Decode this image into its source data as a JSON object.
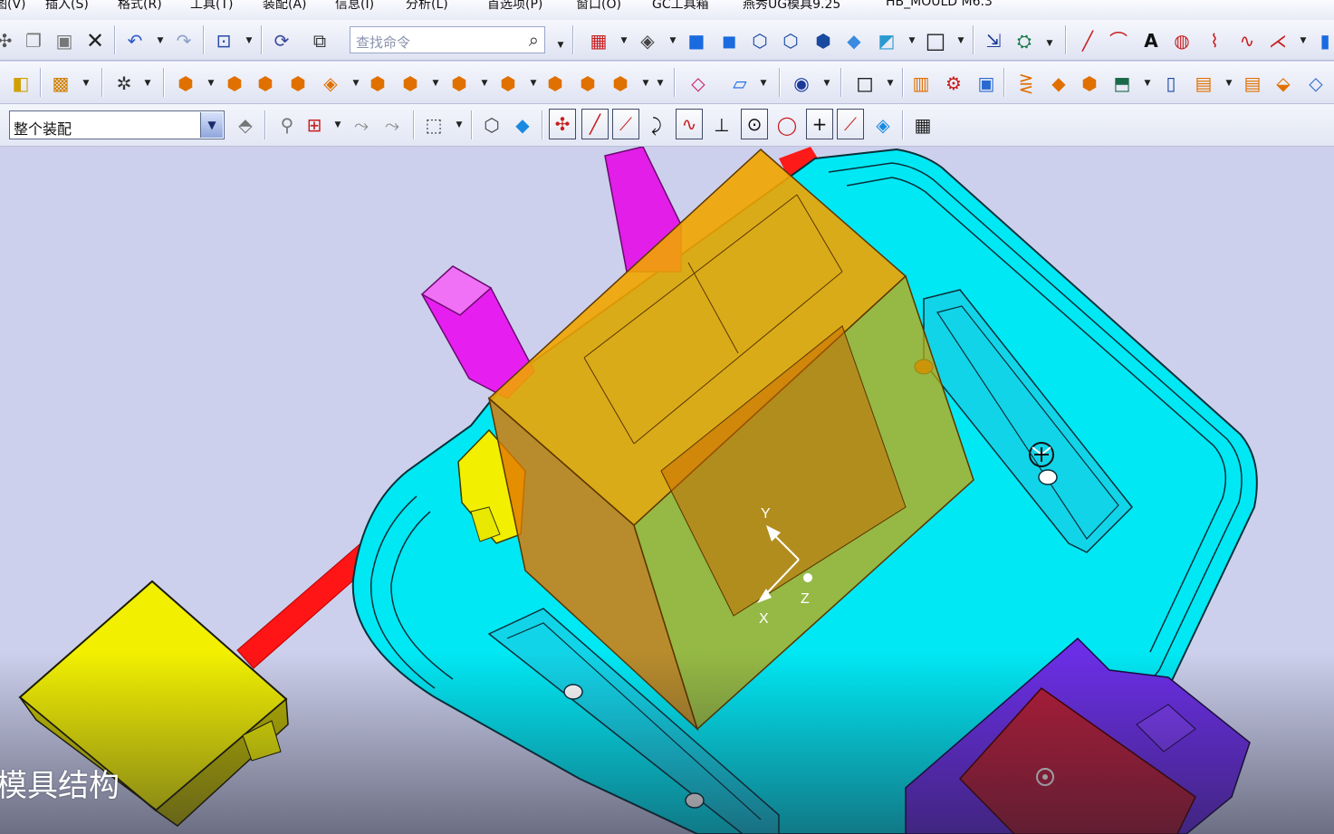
{
  "menubar": {
    "items": [
      "图(V)",
      "插入(S)",
      "格式(R)",
      "工具(T)",
      "装配(A)",
      "信息(I)",
      "分析(L)",
      "首选项(P)",
      "窗口(O)",
      "GC工具箱",
      "燕秀UG模具9.25",
      "HB_MOULD M6.3"
    ]
  },
  "toolbar": {
    "search_placeholder": "查找命令",
    "assembly_filter_value": "整个装配"
  },
  "icons": {
    "row1": [
      "move-icon",
      "copy-icon",
      "paste-icon",
      "delete-icon",
      "undo-icon",
      "redo-icon",
      "wcs-icon",
      "csys-icon",
      "show-hide-icon",
      "search-icon",
      "layout-icon",
      "render-style-icon",
      "shaded-icon",
      "shaded-edges-icon",
      "wireframe-icon",
      "hidden-edge-icon",
      "static-wireframe-icon",
      "face-analysis-icon",
      "section-icon",
      "datum-plane-icon",
      "datum-axis-icon",
      "line-icon",
      "arc-icon",
      "text-icon",
      "sketch-icon",
      "curve-icon",
      "spline-icon",
      "offset-curve-icon",
      "cylinder-icon"
    ],
    "row2": [
      "mold-wizard-icon",
      "project-icon",
      "snap-icon",
      "component-add-icon",
      "component-new-icon",
      "component-replace-icon",
      "component-mirror-icon",
      "component-array-icon",
      "component-move-icon",
      "component-delete-icon",
      "component-suppress-icon",
      "assembly-constraint-icon",
      "exploded-view-icon",
      "reference-set-icon",
      "wave-link-icon",
      "face-icon",
      "sketch-plane-icon",
      "mold-base-icon",
      "standard-part-icon",
      "ejector-pin-icon",
      "slider-icon",
      "lifter-icon",
      "gate-icon",
      "runner-icon",
      "cooling-icon",
      "electrode-icon",
      "pocket-icon",
      "bom-icon",
      "drawing-icon"
    ],
    "row3": [
      "assembly-navigator-icon",
      "filter-icon",
      "select-point-icon",
      "select-face-icon",
      "select-body-icon",
      "box-select-icon",
      "component-icon",
      "solid-icon",
      "snap-existing-point-icon",
      "snap-end-point-icon",
      "snap-mid-point-icon",
      "snap-curve-icon",
      "snap-control-point-icon",
      "snap-intersection-icon",
      "snap-arc-center-icon",
      "snap-quadrant-icon",
      "snap-point-on-curve-icon",
      "snap-point-on-face-icon",
      "snap-bounded-grid-icon",
      "tabular-icon"
    ]
  },
  "viewport": {
    "axis_labels": {
      "x": "X",
      "y": "Y",
      "z": "Z"
    },
    "rotate_cursor": "rotate-icon"
  },
  "caption": "模具结构",
  "colors": {
    "background": "#ccd0ec",
    "cavity": "#00e5f2",
    "transparent_block": "#f2a200",
    "pin": "#e020e8",
    "runner": "#ff1010",
    "slider": "#f2f000",
    "lifter_base": "#6a2ee0"
  }
}
